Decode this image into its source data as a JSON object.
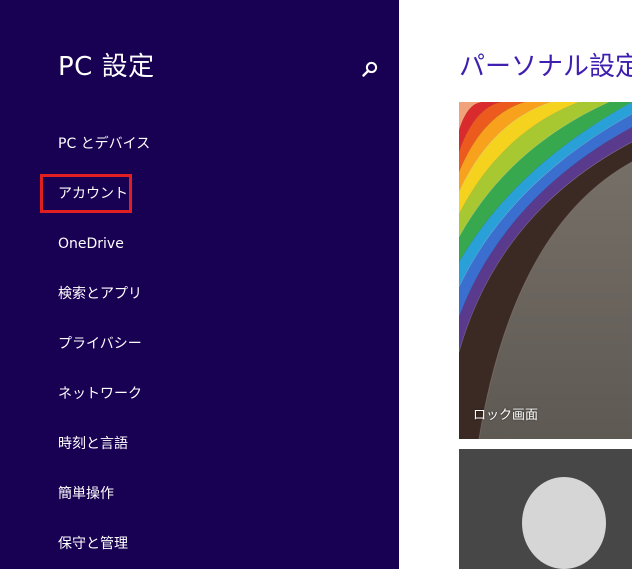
{
  "sidebar": {
    "title": "PC 設定",
    "search_icon": "search-icon",
    "items": [
      {
        "label": "PC とデバイス"
      },
      {
        "label": "アカウント",
        "highlighted": true
      },
      {
        "label": "OneDrive"
      },
      {
        "label": "検索とアプリ"
      },
      {
        "label": "プライバシー"
      },
      {
        "label": "ネットワーク"
      },
      {
        "label": "時刻と言語"
      },
      {
        "label": "簡単操作"
      },
      {
        "label": "保守と管理"
      }
    ]
  },
  "main": {
    "title": "パーソナル設定",
    "tiles": [
      {
        "caption": "ロック画面"
      },
      {
        "caption": ""
      }
    ]
  },
  "colors": {
    "sidebar_bg": "#180052",
    "title_accent": "#3f1fb0",
    "highlight": "#e02020",
    "account_tile_bg": "#474747"
  }
}
